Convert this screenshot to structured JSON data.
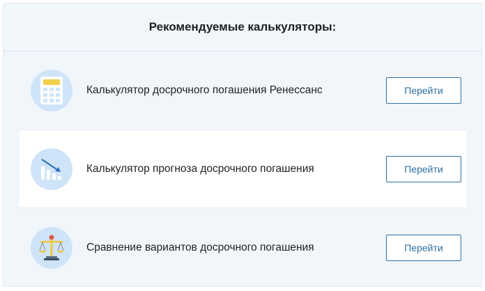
{
  "header": {
    "title": "Рекомендуемые калькуляторы:"
  },
  "items": [
    {
      "label": "Калькулятор досрочного погашения Ренессанс",
      "button": "Перейти",
      "icon": "calculator-icon"
    },
    {
      "label": "Калькулятор прогноза досрочного погашения",
      "button": "Перейти",
      "icon": "decline-chart-icon"
    },
    {
      "label": "Сравнение вариантов досрочного погашения",
      "button": "Перейти",
      "icon": "scales-icon"
    }
  ],
  "colors": {
    "panel_bg": "#f1f6fb",
    "icon_circle": "#cfe4f8",
    "button_border": "#2f6f9f",
    "accent_yellow": "#f2cf4a"
  }
}
